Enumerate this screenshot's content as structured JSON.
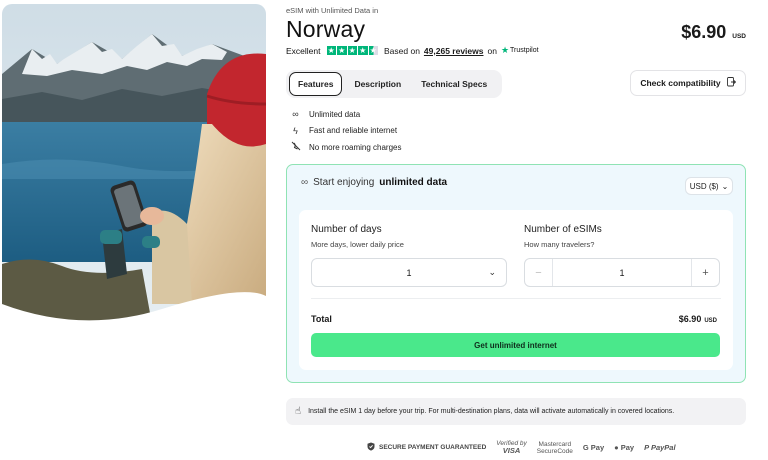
{
  "product": {
    "eyebrow": "eSIM with Unlimited Data in",
    "title": "Norway",
    "price": "$6.90",
    "currency": "USD"
  },
  "rating": {
    "label": "Excellent",
    "stars": 4.5,
    "prefix": "Based on",
    "reviews": "49,265 reviews",
    "on": "on",
    "provider": "Trustpilot"
  },
  "tabs": [
    {
      "label": "Features",
      "active": true
    },
    {
      "label": "Description",
      "active": false
    },
    {
      "label": "Technical Specs",
      "active": false
    }
  ],
  "check_compat": {
    "label": "Check compatibility",
    "icon": "external-link-icon"
  },
  "features": [
    {
      "icon": "infinity-icon",
      "label": "Unlimited data"
    },
    {
      "icon": "lightning-icon",
      "label": "Fast and reliable internet"
    },
    {
      "icon": "no-roaming-icon",
      "label": "No more roaming charges"
    }
  ],
  "card": {
    "head_prefix": "Start enjoying",
    "head_bold": "unlimited data",
    "currency_select": "USD ($)",
    "days": {
      "title": "Number of days",
      "subtitle": "More days, lower daily price",
      "value": "1"
    },
    "esims": {
      "title": "Number of eSIMs",
      "subtitle": "How many travelers?",
      "value": "1",
      "minus": "−",
      "plus": "+"
    },
    "total_label": "Total",
    "total_value": "$6.90",
    "total_currency": "USD",
    "cta": "Get unlimited internet"
  },
  "note": "Install the eSIM 1 day before your trip. For multi-destination plans, data will activate automatically in covered locations.",
  "payments": {
    "secure": "SECURE PAYMENT GUARANTEED",
    "visa_top": "Verified by",
    "visa_bottom": "VISA",
    "mc_top": "Mastercard",
    "mc_bottom": "SecureCode",
    "gpay": "G Pay",
    "apay": " Pay",
    "paypal": "PayPal"
  },
  "colors": {
    "accent": "#4ae88b",
    "trustpilot": "#00b67a",
    "card_bg": "#eef8fd",
    "card_border": "#8fe3b4"
  }
}
